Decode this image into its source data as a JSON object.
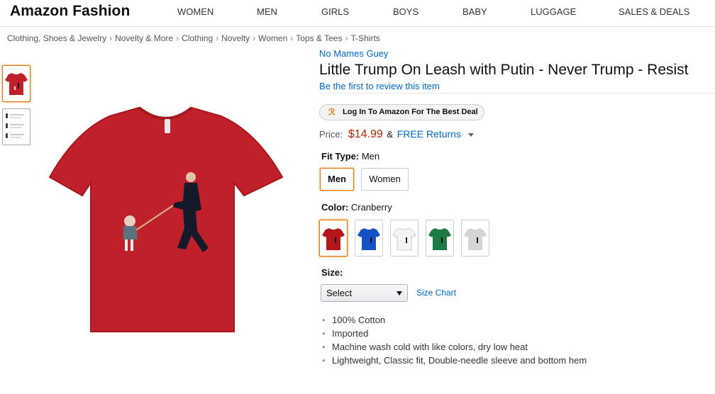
{
  "header": {
    "brand": "Amazon Fashion",
    "nav": [
      "WOMEN",
      "MEN",
      "GIRLS",
      "BOYS",
      "BABY",
      "LUGGAGE",
      "SALES & DEALS"
    ]
  },
  "breadcrumb": [
    "Clothing, Shoes & Jewelry",
    "Novelty & More",
    "Clothing",
    "Novelty",
    "Women",
    "Tops & Tees",
    "T-Shirts"
  ],
  "product": {
    "brand": "No Mames Guey",
    "title": "Little Trump On Leash with Putin - Never Trump - Resist",
    "review_link": "Be the first to review this item",
    "deal_label": "Log In To Amazon For The Best Deal",
    "price_label": "Price:",
    "price": "$14.99",
    "price_amp": "&",
    "returns": "FREE Returns",
    "fit_label": "Fit Type:",
    "fit_value": "Men",
    "fit_options": [
      "Men",
      "Women"
    ],
    "color_label": "Color:",
    "color_value": "Cranberry",
    "swatch_colors": [
      "#b3171c",
      "#1452c4",
      "#f4f4f4",
      "#1e7a43",
      "#d6d4d4"
    ],
    "size_label": "Size:",
    "size_select": "Select",
    "size_chart": "Size Chart",
    "bullets": [
      "100% Cotton",
      "Imported",
      "Machine wash cold with like colors, dry low heat",
      "Lightweight, Classic fit, Double-needle sleeve and bottom hem"
    ],
    "shirt_color": "#c0202a"
  }
}
